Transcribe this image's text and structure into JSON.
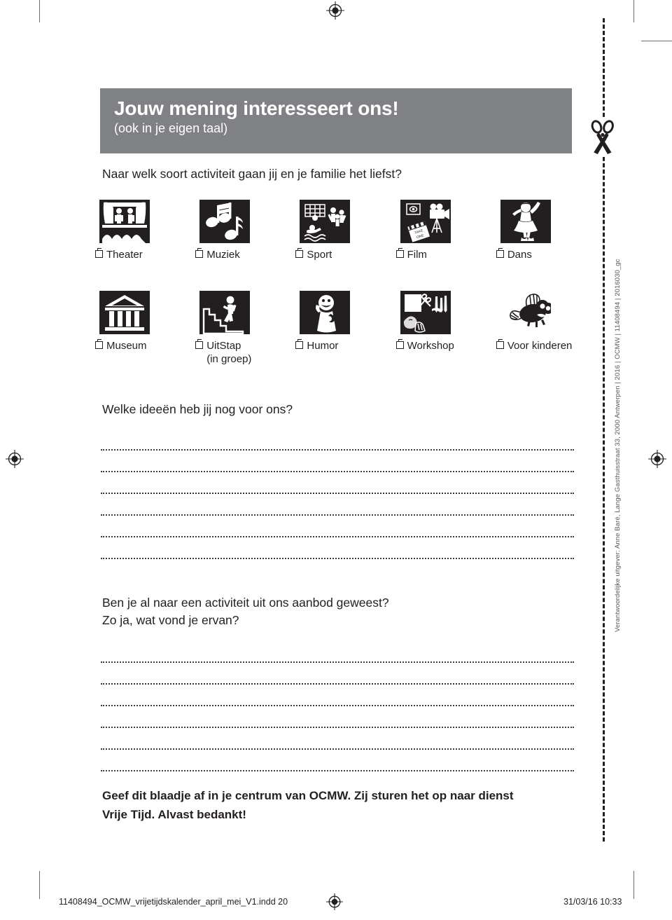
{
  "header": {
    "title": "Jouw mening interesseert ons!",
    "subtitle": "(ook in je eigen taal)"
  },
  "questions": {
    "activity": "Naar welk soort activiteit gaan jij en je familie het liefst?",
    "ideas": "Welke ideeën heb jij nog voor ons?",
    "been_line1": "Ben je al naar een activiteit uit ons aanbod geweest?",
    "been_line2": "Zo ja, wat vond je ervan?"
  },
  "icon_rows": [
    [
      {
        "label": "Theater",
        "sublabel": "",
        "icon": "theater-stage-icon"
      },
      {
        "label": "Muziek",
        "sublabel": "",
        "icon": "music-notes-icon"
      },
      {
        "label": "Sport",
        "sublabel": "",
        "icon": "sport-swim-goal-icon"
      },
      {
        "label": "Film",
        "sublabel": "",
        "icon": "film-camera-clapper-icon"
      },
      {
        "label": "Dans",
        "sublabel": "",
        "icon": "dancer-ballerina-icon"
      }
    ],
    [
      {
        "label": "Museum",
        "sublabel": "",
        "icon": "museum-building-icon"
      },
      {
        "label": "UitStap",
        "sublabel": "(in groep)",
        "icon": "stairs-walker-icon"
      },
      {
        "label": "Humor",
        "sublabel": "",
        "icon": "humor-clown-icon"
      },
      {
        "label": "Workshop",
        "sublabel": "",
        "icon": "workshop-scissors-pencils-icon"
      },
      {
        "label": "Voor kinderen",
        "sublabel": "",
        "icon": "fly-bug-icon"
      }
    ]
  ],
  "answer_lines": {
    "ideas_count": 6,
    "been_count": 6
  },
  "closing": {
    "line1": "Geef dit blaadje af in je centrum van OCMW. Zij sturen het op naar dienst",
    "line2": "Vrije Tijd. Alvast bedankt!"
  },
  "imprint": "Verantwoordelijke uitgever: Anne Baré, Lange Gasthuisstraat 33, 2000 Antwerpen | 2016 | OCMW | 11408494 | 2016030_gc",
  "footer": {
    "file": "11408494_OCMW_vrijetijdskalender_april_mei_V1.indd   20",
    "datetime": "31/03/16   10:33"
  },
  "colors": {
    "header_bar": "#808184",
    "icon_box": "#231f20",
    "text": "#231f20",
    "imprint_text": "#58595b",
    "crop_mark": "#6d6e71"
  }
}
